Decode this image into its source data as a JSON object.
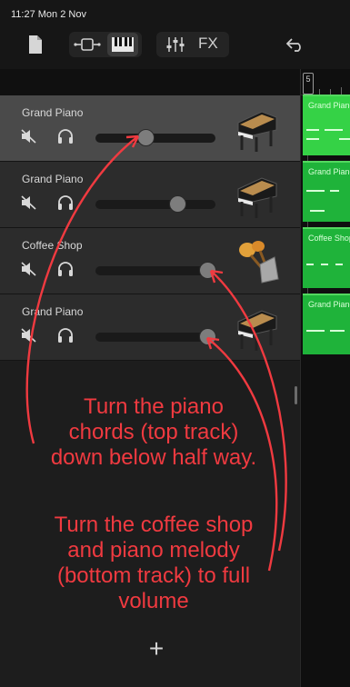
{
  "status": {
    "time": "11:27  Mon 2 Nov"
  },
  "toolbar": {
    "fx_label": "FX"
  },
  "icons": {
    "document": "document-icon",
    "view_tracks": "tracks-view-icon",
    "view_keyboard": "keyboard-icon",
    "mixer": "mixer-icon",
    "undo": "undo-icon",
    "mute": "speaker-muted-icon",
    "solo": "headphones-icon",
    "add": "plus-icon"
  },
  "tracks": [
    {
      "name": "Grand Piano",
      "instrument": "grand-piano",
      "volume": 0.42,
      "selected": true
    },
    {
      "name": "Grand Piano",
      "instrument": "grand-piano",
      "volume": 0.68,
      "selected": false
    },
    {
      "name": "Coffee Shop",
      "instrument": "maracas-cowbell",
      "volume": 0.93,
      "selected": false
    },
    {
      "name": "Grand Piano",
      "instrument": "grand-piano",
      "volume": 0.93,
      "selected": false
    }
  ],
  "regions": [
    {
      "label": "Grand Piano"
    },
    {
      "label": "Grand Piano"
    },
    {
      "label": "Coffee Shop"
    },
    {
      "label": "Grand Piano"
    }
  ],
  "ruler": {
    "bar_label": "5"
  },
  "add_track": {
    "label": "+"
  },
  "annotations": {
    "note1": [
      "Turn the piano",
      "chords (top track)",
      "down below half way."
    ],
    "note2": [
      "Turn the coffee shop",
      "and piano melody",
      "(bottom track) to full",
      "volume"
    ]
  },
  "colors": {
    "annotation": "#f03a40",
    "region": "#1fb33a",
    "region_selected": "#35d246",
    "track_selected": "#4a4a4a",
    "track": "#2c2c2c"
  }
}
